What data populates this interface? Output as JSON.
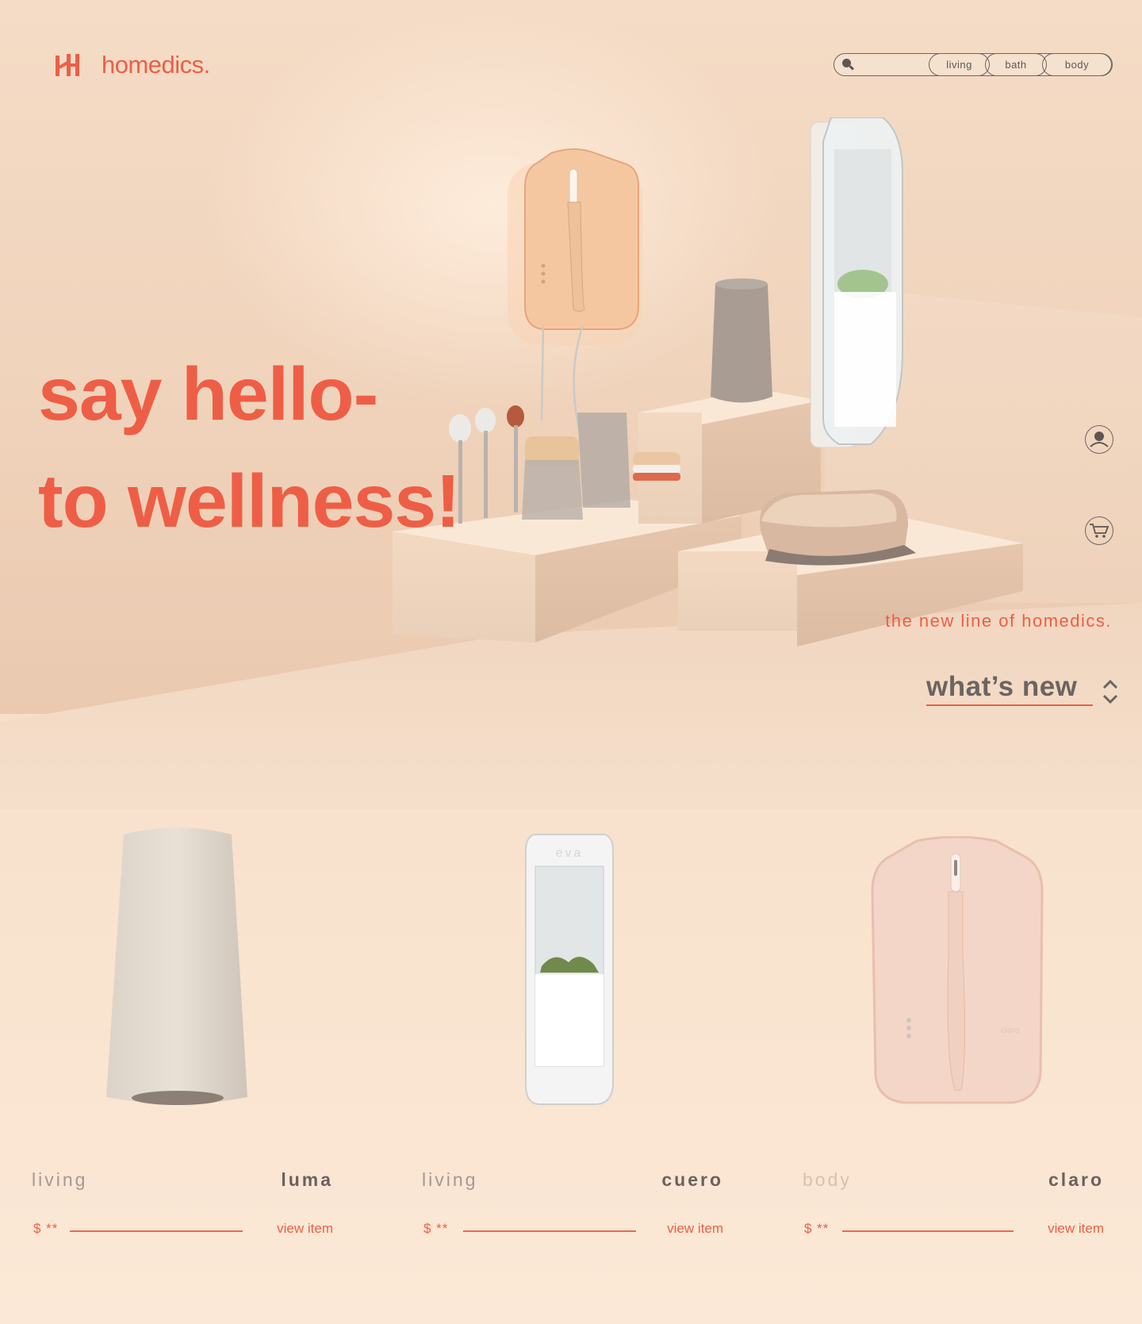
{
  "brand": {
    "name": "homedics.",
    "accent": "#ec5f46"
  },
  "nav": {
    "search_placeholder": "",
    "items": [
      {
        "label": "living"
      },
      {
        "label": "bath"
      },
      {
        "label": "body"
      }
    ]
  },
  "hero": {
    "line1": "say hello-",
    "line2": "to wellness!",
    "tagline": "the new line of homedics.",
    "section_title": "what’s new"
  },
  "products": [
    {
      "category": "living",
      "name": "luma",
      "price": "$ **",
      "link": "view item"
    },
    {
      "category": "living",
      "name": "cuero",
      "price": "$ **",
      "link": "view item",
      "device_label": "eva"
    },
    {
      "category": "body",
      "name": "claro",
      "price": "$ **",
      "link": "view item",
      "device_label": "claro"
    }
  ],
  "icons": {
    "search": "search-icon",
    "user": "user-icon",
    "cart": "cart-icon",
    "sort": "chevron-updown-icon"
  }
}
